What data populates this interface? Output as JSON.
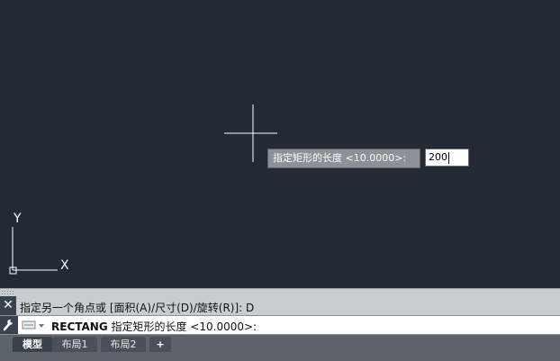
{
  "dynamic_input": {
    "prompt": "指定矩形的长度 <10.0000>:",
    "value": "200"
  },
  "ucs": {
    "x_label": "X",
    "y_label": "Y"
  },
  "command": {
    "history": "指定另一个角点或 [面积(A)/尺寸(D)/旋转(R)]: D",
    "current_command": "RECTANG",
    "current_prompt": " 指定矩形的长度 <10.0000>:"
  },
  "tabs": [
    {
      "label": "模型",
      "active": true
    },
    {
      "label": "布局1",
      "active": false
    },
    {
      "label": "布局2",
      "active": false
    },
    {
      "label": "+",
      "active": false
    }
  ],
  "icons": {
    "close": "close-icon",
    "wrench": "wrench-icon",
    "crosshair": "crosshair-cursor-icon"
  },
  "colors": {
    "canvas_bg": "#222a35",
    "tooltip_bg": "#8d9196",
    "command_bg": "#c9ccd0"
  }
}
